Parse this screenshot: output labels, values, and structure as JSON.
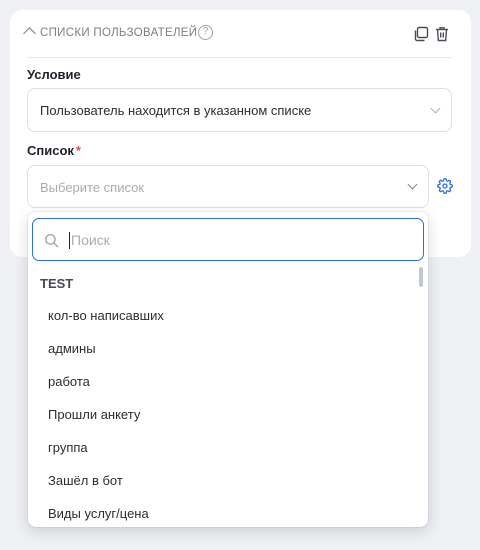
{
  "section": {
    "title": "СПИСКИ ПОЛЬЗОВАТЕЛЕЙ",
    "help_glyph": "?"
  },
  "condition": {
    "label": "Условие",
    "value": "Пользователь находится в указанном списке"
  },
  "list_field": {
    "label": "Список",
    "required_mark": "*",
    "placeholder": "Выберите список"
  },
  "dropdown": {
    "search_placeholder": "Поиск",
    "group_label": "TEST",
    "options": [
      "кол-во написавших",
      "админы",
      "работа",
      "Прошли анкету",
      "группа",
      "Зашёл в бот",
      "Виды услуг/цена"
    ]
  },
  "colors": {
    "accent": "#2f6fe4",
    "required": "#e5484d",
    "muted_text": "#7a7f87"
  }
}
